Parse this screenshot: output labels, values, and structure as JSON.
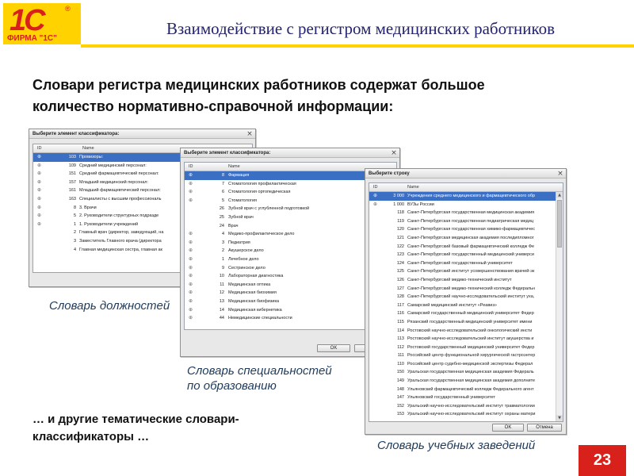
{
  "logo": {
    "emblem": "1С",
    "reg": "®",
    "text": "ФИРМА \"1С\""
  },
  "header": {
    "title": "Взаимодействие с регистром медицинских работников"
  },
  "intro": {
    "line1": "Словари регистра медицинских работников содержат большое",
    "line2": "количество нормативно-справочной информации:"
  },
  "dialogs": {
    "positions": {
      "title": "Выберите элемент классификатора:",
      "close_icon": "close-icon",
      "col_id": "ID",
      "col_name": "Name",
      "rows": [
        {
          "id": "103",
          "name": "Провизоры:"
        },
        {
          "id": "109",
          "name": "Средний медицинский персонал:"
        },
        {
          "id": "151",
          "name": "Средний фармацевтический персонал:"
        },
        {
          "id": "157",
          "name": "Младший медицинский персонал:"
        },
        {
          "id": "161",
          "name": "Младший фармацевтический персонал:"
        },
        {
          "id": "163",
          "name": "Специалисты с высшим профессиональ"
        },
        {
          "id": "8",
          "name": "3. Врачи"
        },
        {
          "id": "5",
          "name": "2. Руководители структурных подразде"
        },
        {
          "id": "1",
          "name": "1. Руководители учреждений"
        },
        {
          "id": "2",
          "name": "Главный врач (директор, заведующий, на"
        },
        {
          "id": "3",
          "name": "Заместитель Главного врача (директора"
        },
        {
          "id": "4",
          "name": "Главная медицинская сестра, главная ак"
        }
      ]
    },
    "specialties": {
      "title": "Выберите элемент классификатора:",
      "close_icon": "close-icon",
      "col_id": "ID",
      "col_name": "Name",
      "ok": "OK",
      "rows": [
        {
          "id": "8",
          "name": "Фармация"
        },
        {
          "id": "7",
          "name": "Стоматология профилактическая"
        },
        {
          "id": "6",
          "name": "Стоматология ортопедическая"
        },
        {
          "id": "5",
          "name": "Стоматология"
        },
        {
          "id": "26",
          "name": "Зубной врач с углубленной подготовкой"
        },
        {
          "id": "25",
          "name": "Зубной врач"
        },
        {
          "id": "24",
          "name": "Врач"
        },
        {
          "id": "4",
          "name": "Медико-профилактическое дело"
        },
        {
          "id": "3",
          "name": "Педиатрия"
        },
        {
          "id": "2",
          "name": "Акушерское дело"
        },
        {
          "id": "1",
          "name": "Лечебное дело"
        },
        {
          "id": "9",
          "name": "Сестринское дело"
        },
        {
          "id": "10",
          "name": "Лабораторная диагностика"
        },
        {
          "id": "11",
          "name": "Медицинская оптика"
        },
        {
          "id": "12",
          "name": "Медицинская биохимия"
        },
        {
          "id": "13",
          "name": "Медицинская биофизика"
        },
        {
          "id": "14",
          "name": "Медицинская кибернетика"
        },
        {
          "id": "44",
          "name": "Немедицинские специальности"
        }
      ]
    },
    "institutions": {
      "title": "Выберите строку",
      "close_icon": "close-icon",
      "col_id": "ID",
      "col_name": "Name",
      "ok": "OK",
      "cancel": "Отмена",
      "rows": [
        {
          "id": "3 000",
          "name": "Учреждения среднего медицинского и фармацевтического обр"
        },
        {
          "id": "1 000",
          "name": "ВУЗы России"
        },
        {
          "id": "118",
          "name": "Санкт-Петербургская государственная медицинская академия"
        },
        {
          "id": "119",
          "name": "Санкт-Петербургская государственная педиатрическая медиц"
        },
        {
          "id": "120",
          "name": "Санкт-Петербургская государственная химико-фармацевтичес"
        },
        {
          "id": "121",
          "name": "Санкт-Петербургская медицинская академия последипломног"
        },
        {
          "id": "122",
          "name": "Санкт-Петербургский базовый фармацевтический колледж Фе"
        },
        {
          "id": "123",
          "name": "Санкт-Петербургский государственный медицинский универси"
        },
        {
          "id": "124",
          "name": "Санкт-Петербургский государственный университет"
        },
        {
          "id": "125",
          "name": "Санкт-Петербургский институт усовершенствования врачей-эк"
        },
        {
          "id": "126",
          "name": "Санкт-Петербургский медико-технический институт"
        },
        {
          "id": "127",
          "name": "Санкт-Петербургский медико-технический колледж Федеральн"
        },
        {
          "id": "128",
          "name": "Санкт-Петербургский научно-исследовательский институт уха,"
        },
        {
          "id": "117",
          "name": "Самарский медицинский институт «Реавиз»"
        },
        {
          "id": "116",
          "name": "Самарский государственный медицинский университет Федер"
        },
        {
          "id": "115",
          "name": "Рязанский государственный медицинский университет имени"
        },
        {
          "id": "114",
          "name": "Ростовский научно-исследовательский онкологический инсти"
        },
        {
          "id": "113",
          "name": "Ростовский научно-исследовательский институт акушерства и"
        },
        {
          "id": "112",
          "name": "Ростовский государственный медицинский университет Федер"
        },
        {
          "id": "111",
          "name": "Российский центр функциональной хирургической гастроэнтер"
        },
        {
          "id": "110",
          "name": "Российский центр судебно-медицинской экспертизы Федерал"
        },
        {
          "id": "150",
          "name": "Уральская государственная медицинская академия Федераль"
        },
        {
          "id": "149",
          "name": "Уральская государственная медицинская академия дополните"
        },
        {
          "id": "148",
          "name": "Ульяновский фармацевтический колледж Федерального агент"
        },
        {
          "id": "147",
          "name": "Ульяновский государственный университет"
        },
        {
          "id": "152",
          "name": "Уральский научно-исследовательский институт травматологии"
        },
        {
          "id": "153",
          "name": "Уральский научно-исследовательский институт охраны матери"
        }
      ]
    }
  },
  "captions": {
    "positions": "Словарь должностей",
    "specialties_line1": "Словарь специальностей",
    "specialties_line2": "по образованию",
    "institutions": "Словарь учебных заведений"
  },
  "outro": {
    "line1": "… и другие тематические словари-",
    "line2": "классификаторы …"
  },
  "page_number": "23",
  "colors": {
    "brand_red": "#d8211b",
    "brand_yellow": "#ffd200",
    "title_blue": "#23236d",
    "selection": "#3b6fc4"
  }
}
